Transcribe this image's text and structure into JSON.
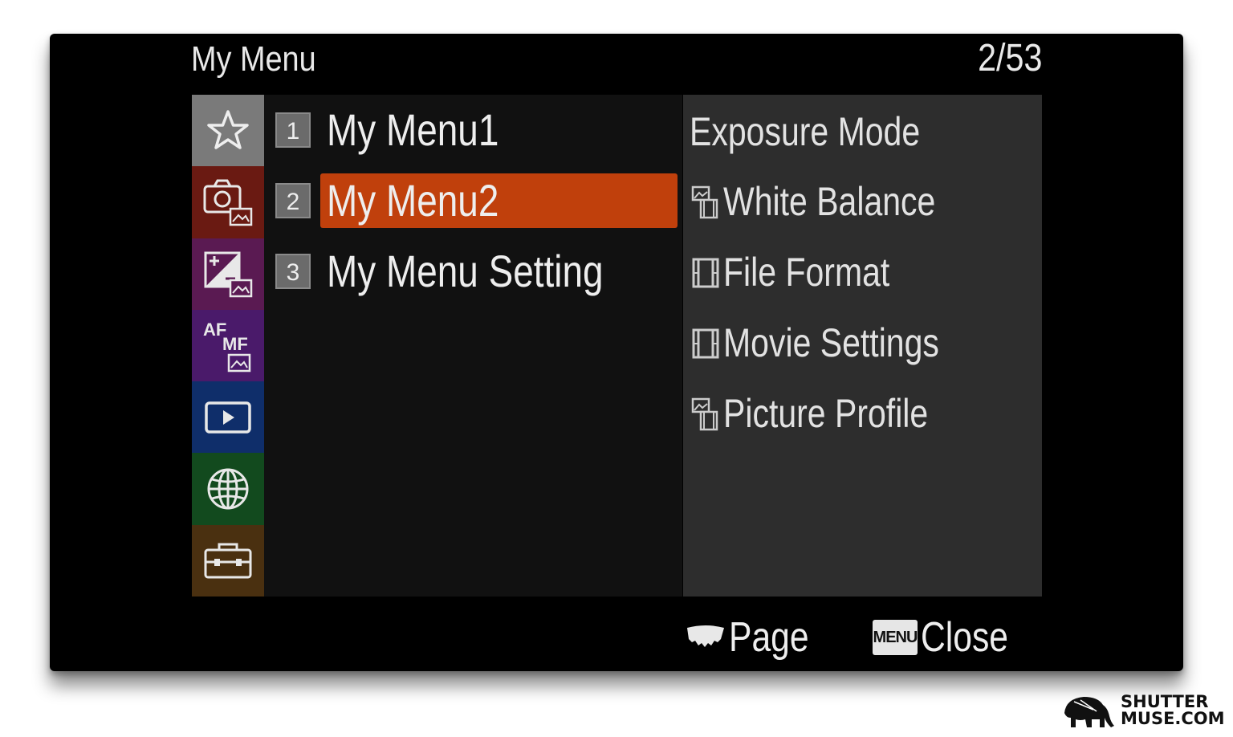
{
  "header": {
    "title": "My Menu",
    "page_indicator": "2/53"
  },
  "sidebar": {
    "tabs": [
      {
        "name": "my-menu",
        "icon": "star-icon",
        "color": "#7a7a7a",
        "active": true
      },
      {
        "name": "shooting",
        "icon": "camera-icon",
        "color": "#6a1a12"
      },
      {
        "name": "exposure-color",
        "icon": "exposure-compensation-icon",
        "color": "#5a1a52"
      },
      {
        "name": "focus",
        "icon": "af-mf-icon",
        "color": "#4a1a6a",
        "af_text": "AF",
        "mf_text": "MF"
      },
      {
        "name": "playback",
        "icon": "play-icon",
        "color": "#0f2e6a"
      },
      {
        "name": "network",
        "icon": "globe-icon",
        "color": "#124a1e"
      },
      {
        "name": "setup",
        "icon": "toolbox-icon",
        "color": "#4a3010"
      }
    ]
  },
  "menu": {
    "items": [
      {
        "number": "1",
        "label": "My Menu1",
        "selected": false
      },
      {
        "number": "2",
        "label": "My Menu2",
        "selected": true
      },
      {
        "number": "3",
        "label": "My Menu Setting",
        "selected": false
      }
    ],
    "selected_color": "#c0400c"
  },
  "preview": {
    "items": [
      {
        "label": "Exposure Mode",
        "icon": ""
      },
      {
        "label": "White Balance",
        "icon": "photo-movie-icon"
      },
      {
        "label": "File Format",
        "icon": "film-icon"
      },
      {
        "label": "Movie Settings",
        "icon": "film-icon"
      },
      {
        "label": "Picture Profile",
        "icon": "photo-movie-icon"
      }
    ]
  },
  "footer": {
    "page_label": "Page",
    "menu_key": "MENU",
    "close_label": "Close"
  },
  "watermark": {
    "line1": "SHUTTER",
    "line2": "MUSE.COM"
  }
}
